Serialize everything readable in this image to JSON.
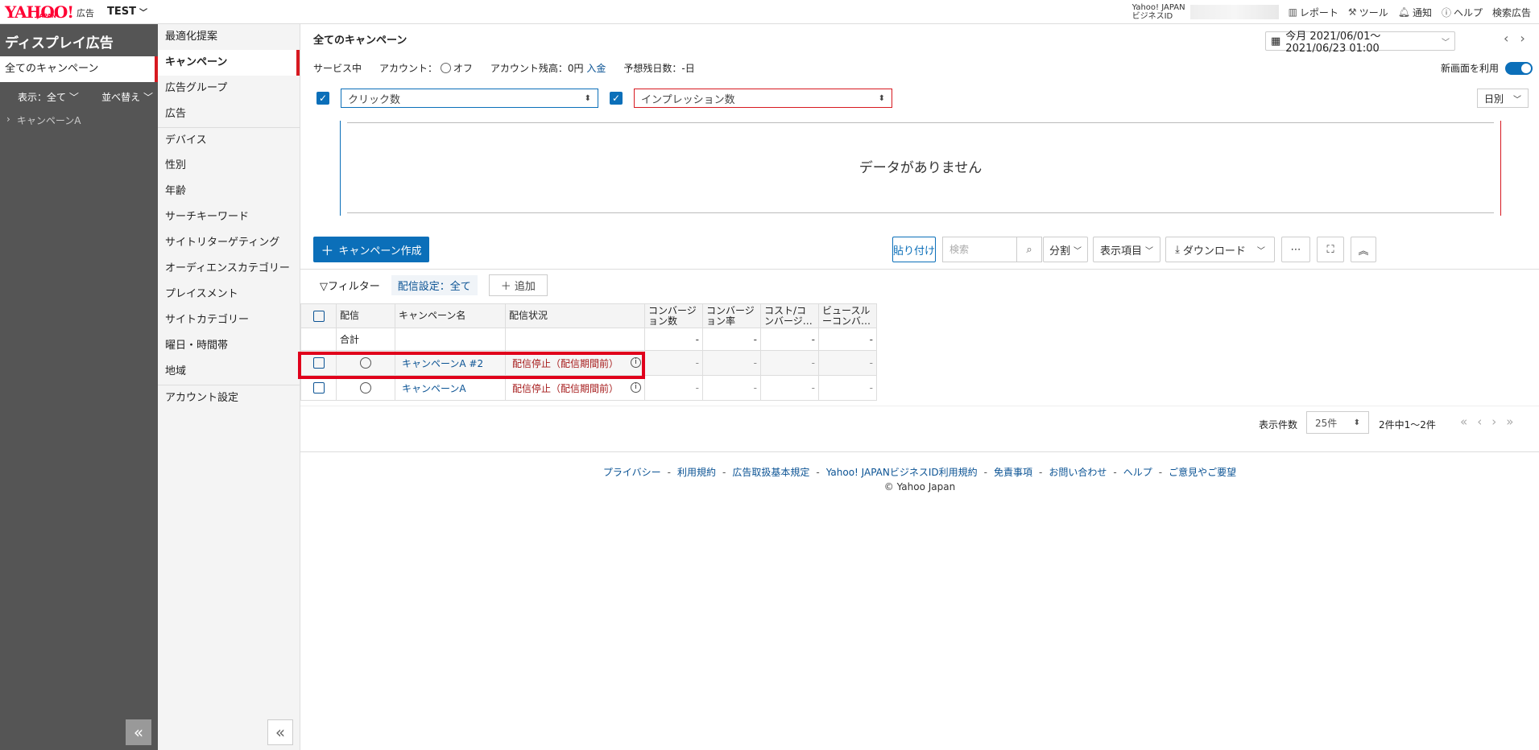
{
  "topbar": {
    "logo": "YAHOO!",
    "logo_sub": "JAPAN",
    "logo_ad": "広告",
    "account": "TEST",
    "bizid_line1": "Yahoo! JAPAN",
    "bizid_line2": "ビジネスID",
    "links": [
      "レポート",
      "ツール",
      "通知",
      "ヘルプ"
    ],
    "search_ads": "検索広告"
  },
  "sidebar": {
    "title": "ディスプレイ広告",
    "all_campaigns": "全てのキャンペーン",
    "display_filter": "表示：全て",
    "sort": "並べ替え",
    "campaign": "キャンペーンA"
  },
  "menu": {
    "items": [
      "最適化提案",
      "キャンペーン",
      "広告グループ",
      "広告",
      "デバイス",
      "性別",
      "年齢",
      "サーチキーワード",
      "サイトリターゲティング",
      "オーディエンスカテゴリー",
      "プレイスメント",
      "サイトカテゴリー",
      "曜日・時間帯",
      "地域",
      "アカウント設定"
    ],
    "active": "キャンペーン"
  },
  "main": {
    "title": "全てのキャンペーン",
    "date_range": "今月 2021/06/01～2021/06/23 01:00",
    "status": "サービス中",
    "account_label": "アカウント：",
    "account_off": "オフ",
    "balance": "アカウント残高：0円",
    "deposit": "入金",
    "days_left": "予想残日数：-日",
    "new_screen": "新画面を利用",
    "metric1": "クリック数",
    "metric2": "インプレッション数",
    "granularity": "日別",
    "no_data": "データがありません"
  },
  "toolbar": {
    "create": "キャンペーン作成",
    "paste": "貼り付け",
    "search_placeholder": "検索",
    "segment": "分割",
    "columns": "表示項目",
    "download": "ダウンロード",
    "more": "⋯"
  },
  "filters": {
    "filter": "フィルター",
    "delivery_setting": "配信設定：全て",
    "add": "追加"
  },
  "table": {
    "headers": [
      "配信",
      "キャンペーン名",
      "配信状況",
      "コンバージョン数",
      "コンバージョン率",
      "コスト/コンバージ…",
      "ビュースルーコンバ…"
    ],
    "total_label": "合計",
    "total_values": [
      "-",
      "-",
      "-",
      "-"
    ],
    "rows": [
      {
        "name": "キャンペーンA #2",
        "status": "配信停止（配信期間前）",
        "values": [
          "-",
          "-",
          "-",
          "-"
        ]
      },
      {
        "name": "キャンペーンA",
        "status": "配信停止（配信期間前）",
        "values": [
          "-",
          "-",
          "-",
          "-"
        ]
      }
    ]
  },
  "pager": {
    "label": "表示件数",
    "per_page": "25件",
    "count": "2件中1～2件"
  },
  "footer": {
    "links": [
      "プライバシー",
      "利用規約",
      "広告取扱基本規定",
      "Yahoo! JAPANビジネスID利用規約",
      "免責事項",
      "お問い合わせ",
      "ヘルプ",
      "ご意見やご要望"
    ],
    "copyright": "© Yahoo Japan"
  }
}
